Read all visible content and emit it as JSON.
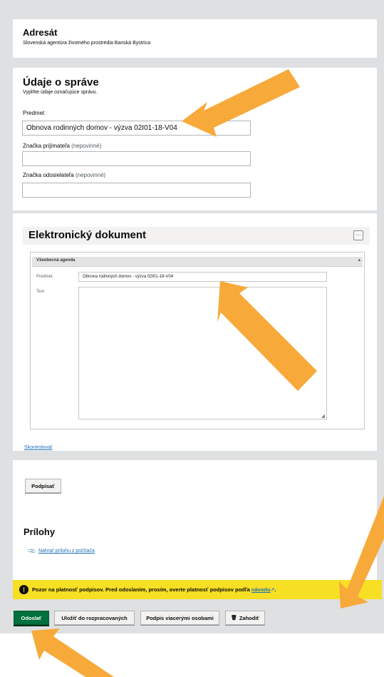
{
  "recipient": {
    "title": "Adresát",
    "value": "Slovenská agentúra životného prostredia Banská Bystrica"
  },
  "message": {
    "title": "Údaje o správe",
    "subtitle": "Vyplňte údaje označujúce správu.",
    "subject_label": "Predmet",
    "subject_value": "Obnova rodinných domov - výzva 02I01-18-V04",
    "recipient_ref_label": "Značka prijímateľa",
    "sender_ref_label": "Značka odosielateľa",
    "optional": "(nepovinné)"
  },
  "edoc": {
    "title": "Elektronický dokument",
    "more_button": "···",
    "panel_header": "Všeobecná agenda",
    "subject_label": "Predmet",
    "subject_value": "Obnova rodinných domov - výzva 02I01-18-V04",
    "text_label": "Text",
    "check_link": "Skontrolovať"
  },
  "sign": {
    "button": "Podpísať"
  },
  "attachments": {
    "title": "Prílohy",
    "upload_link": "Nahrať prílohu z počítača"
  },
  "warning": {
    "text": "Pozor na platnosť podpisov. Pred odoslaním, prosím, overte platnosť podpisov podľa",
    "link": "návodu",
    "end": "."
  },
  "actions": {
    "send": "Odoslať",
    "save_draft": "Uložiť do rozpracovaných",
    "multi_sign": "Podpis viacerými osobami",
    "discard": "Zahodiť"
  },
  "colors": {
    "arrow": "#f7a93a",
    "warning_bg": "#f7df24",
    "send_green": "#00703c",
    "link_blue": "#1d70b8"
  }
}
